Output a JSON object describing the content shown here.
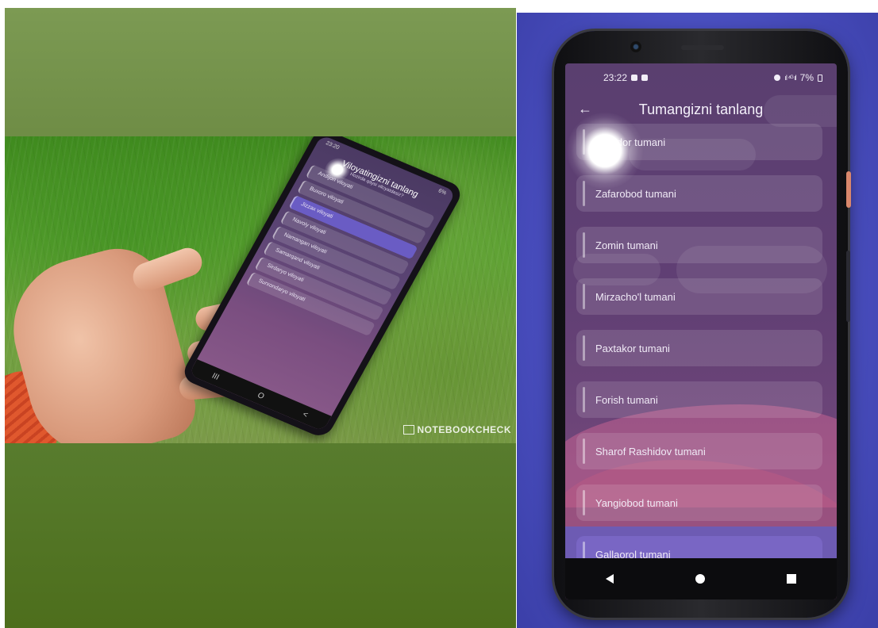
{
  "left_photo": {
    "mini_screen": {
      "time": "23:20",
      "battery": "6%",
      "title": "Viloyatingizni tanlang",
      "subtitle": "Hozirda qaysi viloyatdasiz?",
      "items": [
        {
          "label": "Andijon viloyati",
          "active": false
        },
        {
          "label": "Buxoro viloyati",
          "active": false
        },
        {
          "label": "Jizzax viloyati",
          "active": true
        },
        {
          "label": "Navoiy viloyati",
          "active": false
        },
        {
          "label": "Namangan viloyati",
          "active": false
        },
        {
          "label": "Samarqand viloyati",
          "active": false
        },
        {
          "label": "Sirdaryo viloyati",
          "active": false
        },
        {
          "label": "Surxondaryo viloyati",
          "active": false
        }
      ],
      "nav": {
        "recent": "III",
        "home": "O",
        "back": "<"
      }
    },
    "watermark": "NOTEBOOKCHECK"
  },
  "phone": {
    "status": {
      "time": "23:22",
      "signal": "ıl ⁴ᴳ ıl",
      "battery": "7%"
    },
    "header": {
      "title": "Tumangizni tanlang",
      "back_icon": "arrow-left-icon"
    },
    "districts": [
      {
        "label": "Zarbdor tumani",
        "active": false
      },
      {
        "label": "Zafarobod tumani",
        "active": false
      },
      {
        "label": "Zomin tumani",
        "active": false
      },
      {
        "label": "Mirzacho'l tumani",
        "active": false
      },
      {
        "label": "Paxtakor  tumani",
        "active": false
      },
      {
        "label": "Forish tumani",
        "active": false
      },
      {
        "label": "Sharof Rashidov tumani",
        "active": false
      },
      {
        "label": "Yangiobod tumani",
        "active": false
      },
      {
        "label": "Gallaorol tumani",
        "active": true
      }
    ],
    "nav": {
      "back_icon": "triangle-back-icon",
      "home_icon": "circle-home-icon",
      "recent_icon": "square-recent-icon"
    }
  }
}
